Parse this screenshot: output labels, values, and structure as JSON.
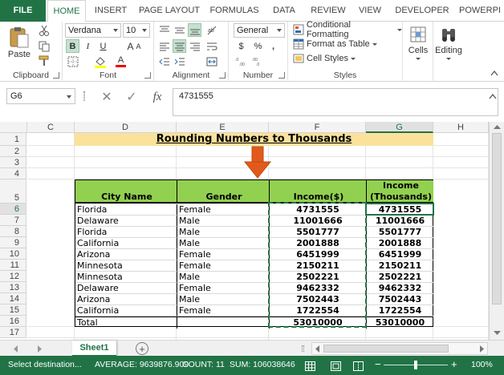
{
  "ribbon_tabs": [
    "FILE",
    "HOME",
    "INSERT",
    "PAGE LAYOUT",
    "FORMULAS",
    "DATA",
    "REVIEW",
    "VIEW",
    "DEVELOPER",
    "POWERPI"
  ],
  "active_tab": "HOME",
  "clipboard": {
    "paste_label": "Paste",
    "group_label": "Clipboard"
  },
  "font": {
    "name": "Verdana",
    "size": "10",
    "bold_label": "B",
    "italic_label": "I",
    "underline_label": "U",
    "font_color_label": "A",
    "group_label": "Font"
  },
  "alignment": {
    "group_label": "Alignment"
  },
  "number": {
    "format": "General",
    "currency_label": "$",
    "percent_label": "%",
    "comma_label": ",",
    "group_label": "Number"
  },
  "styles": {
    "conditional_formatting": "Conditional Formatting",
    "format_as_table": "Format as Table",
    "cell_styles": "Cell Styles",
    "group_label": "Styles"
  },
  "cells": {
    "label": "Cells"
  },
  "editing": {
    "label": "Editing"
  },
  "formula_bar": {
    "name_box": "G6",
    "cancel_label": "✕",
    "enter_label": "✓",
    "fx_label": "fx",
    "content": "4731555"
  },
  "grid": {
    "columns": [
      "C",
      "D",
      "E",
      "F",
      "G",
      "H"
    ],
    "rows": [
      "1",
      "2",
      "3",
      "4",
      "5",
      "6",
      "7",
      "8",
      "9",
      "10",
      "11",
      "12",
      "13",
      "14",
      "15",
      "16",
      "17"
    ],
    "title": "Rounding Numbers to Thousands",
    "headers": {
      "city": "City Name",
      "gender": "Gender",
      "income": "Income($)",
      "thousands_line1": "Income",
      "thousands_line2": "(Thousands)"
    },
    "data_rows": [
      {
        "city": "Florida",
        "gender": "Female",
        "income": "4731555",
        "thousands": "4731555"
      },
      {
        "city": "Delaware",
        "gender": "Male",
        "income": "11001666",
        "thousands": "11001666"
      },
      {
        "city": "Florida",
        "gender": "Male",
        "income": "5501777",
        "thousands": "5501777"
      },
      {
        "city": "California",
        "gender": "Male",
        "income": "2001888",
        "thousands": "2001888"
      },
      {
        "city": "Arizona",
        "gender": "Female",
        "income": "6451999",
        "thousands": "6451999"
      },
      {
        "city": "Minnesota",
        "gender": "Female",
        "income": "2150211",
        "thousands": "2150211"
      },
      {
        "city": "Minnesota",
        "gender": "Male",
        "income": "2502221",
        "thousands": "2502221"
      },
      {
        "city": "Delaware",
        "gender": "Female",
        "income": "9462332",
        "thousands": "9462332"
      },
      {
        "city": "Arizona",
        "gender": "Male",
        "income": "7502443",
        "thousands": "7502443"
      },
      {
        "city": "California",
        "gender": "Female",
        "income": "1722554",
        "thousands": "1722554"
      }
    ],
    "total": {
      "label": "Total",
      "income": "53010000",
      "thousands": "53010000"
    }
  },
  "sheets": [
    "Sheet1"
  ],
  "add_sheet_label": "+",
  "status": {
    "mode": "Select destination...",
    "average": "AVERAGE: 9639876.909",
    "count": "COUNT: 11",
    "sum": "SUM: 106038646",
    "zoom": "100%",
    "zoom_out": "−",
    "zoom_in": "+"
  },
  "colors": {
    "excel_green": "#217346",
    "header_fill": "#92d050",
    "title_fill": "#fbe29b",
    "arrow": "#e15a1c"
  }
}
